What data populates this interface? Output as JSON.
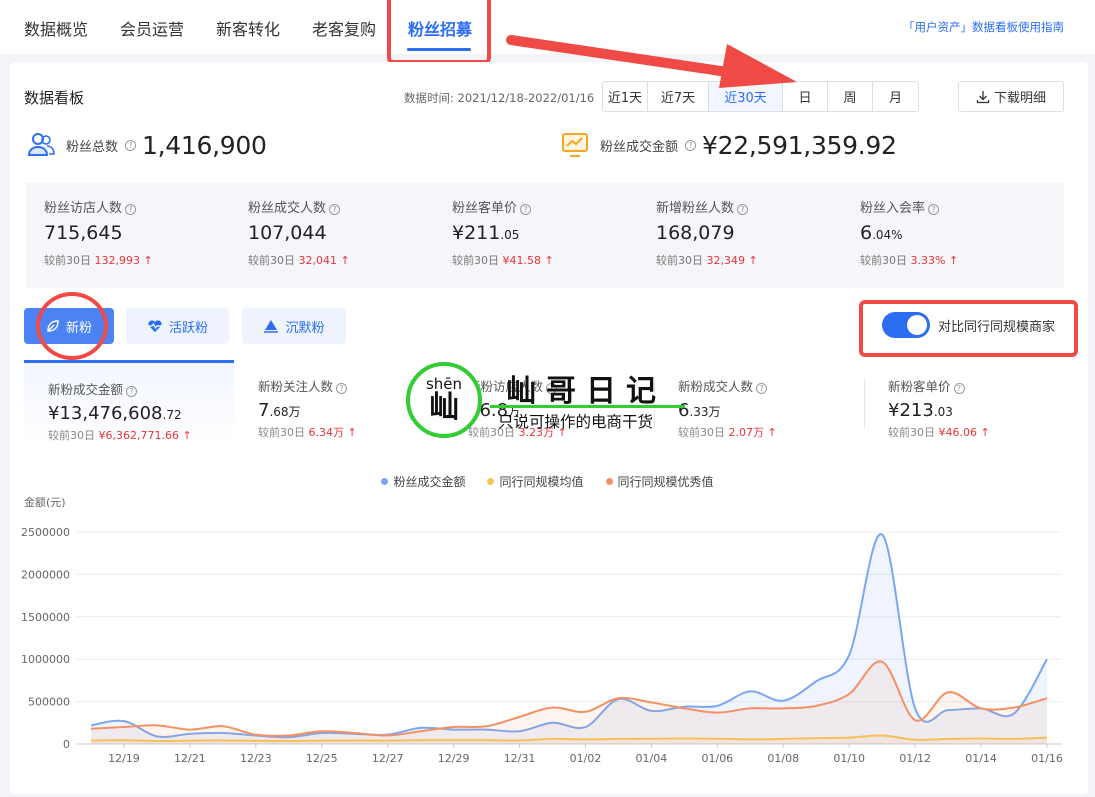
{
  "nav": {
    "tabs": [
      "数据概览",
      "会员运营",
      "新客转化",
      "老客复购",
      "粉丝招募"
    ],
    "active_tab": "粉丝招募",
    "help_link": "「用户资产」数据看板使用指南"
  },
  "panel": {
    "title": "数据看板",
    "data_time_label": "数据时间:",
    "data_time_value": "2021/12/18-2022/01/16",
    "ranges": [
      "近1天",
      "近7天",
      "近30天",
      "日",
      "周",
      "月"
    ],
    "active_range": "近30天",
    "download_label": "下载明细"
  },
  "kpis": [
    {
      "label": "粉丝总数",
      "value": "1,416,900",
      "icon": "users-icon"
    },
    {
      "label": "粉丝成交金额",
      "value": "¥22,591,359.92",
      "icon": "trend-chart-icon"
    }
  ],
  "metrics": [
    {
      "label": "粉丝访店人数",
      "value_main": "715,645",
      "value_small": "",
      "compare_label": "较前30日",
      "compare_value": "132,993"
    },
    {
      "label": "粉丝成交人数",
      "value_main": "107,044",
      "value_small": "",
      "compare_label": "较前30日",
      "compare_value": "32,041"
    },
    {
      "label": "粉丝客单价",
      "value_main": "¥211",
      "value_small": ".05",
      "compare_label": "较前30日",
      "compare_value": "¥41.58"
    },
    {
      "label": "新增粉丝人数",
      "value_main": "168,079",
      "value_small": "",
      "compare_label": "较前30日",
      "compare_value": "32,349"
    },
    {
      "label": "粉丝入会率",
      "value_main": "6",
      "value_small": ".04%",
      "compare_label": "较前30日",
      "compare_value": "3.33%"
    }
  ],
  "segments": [
    {
      "label": "新粉",
      "icon": "leaf-icon"
    },
    {
      "label": "活跃粉",
      "icon": "heart-pulse-icon"
    },
    {
      "label": "沉默粉",
      "icon": "water-drop-icon"
    }
  ],
  "toggle_label": "对比同行同规模商家",
  "sub_metrics": [
    {
      "label": "新粉成交金额",
      "value_main": "¥13,476,608",
      "value_small": ".72",
      "compare_label": "较前30日",
      "compare_value": "¥6,362,771.66"
    },
    {
      "label": "新粉关注人数",
      "value_main": "7",
      "value_small": ".68万",
      "compare_label": "较前30日",
      "compare_value": "6.34万"
    },
    {
      "label": "新粉访店人数",
      "value_main": "16.8",
      "value_small": "万",
      "compare_label": "较前30日",
      "compare_value": "3.23万"
    },
    {
      "label": "新粉成交人数",
      "value_main": "6",
      "value_small": ".33万",
      "compare_label": "较前30日",
      "compare_value": "2.07万"
    },
    {
      "label": "新粉客单价",
      "value_main": "¥213",
      "value_small": ".03",
      "compare_label": "较前30日",
      "compare_value": "¥46.06"
    }
  ],
  "watermark": {
    "pinyin": "shēn",
    "char": "屾",
    "title": "屾哥日记",
    "slogan": "只说可操作的电商干货"
  },
  "colors": {
    "accent": "#2b6ef2",
    "series_blue": "#7ba6f3",
    "series_yellow": "#f7c55a",
    "series_orange": "#f49164",
    "up_red": "#e8343a",
    "annotation_red": "#ef4a45",
    "watermark_green": "#33cc33"
  },
  "chart_data": {
    "type": "line",
    "ylabel": "金额(元)",
    "ylim": [
      0,
      2500000
    ],
    "y_ticks": [
      "0",
      "500000",
      "1000000",
      "1500000",
      "2000000",
      "2500000"
    ],
    "x": [
      "12/18",
      "12/19",
      "12/20",
      "12/21",
      "12/22",
      "12/23",
      "12/24",
      "12/25",
      "12/26",
      "12/27",
      "12/28",
      "12/29",
      "12/30",
      "12/31",
      "01/01",
      "01/02",
      "01/03",
      "01/04",
      "01/05",
      "01/06",
      "01/07",
      "01/08",
      "01/09",
      "01/10",
      "01/11",
      "01/12",
      "01/13",
      "01/14",
      "01/15",
      "01/16"
    ],
    "x_tick_labels": [
      "12/19",
      "12/21",
      "12/23",
      "12/25",
      "12/27",
      "12/29",
      "12/31",
      "01/02",
      "01/04",
      "01/06",
      "01/08",
      "01/10",
      "01/12",
      "01/14",
      "01/16"
    ],
    "series": [
      {
        "name": "粉丝成交金额",
        "values": [
          220000,
          270000,
          90000,
          120000,
          130000,
          100000,
          80000,
          130000,
          120000,
          110000,
          190000,
          170000,
          170000,
          150000,
          250000,
          200000,
          530000,
          390000,
          440000,
          450000,
          620000,
          510000,
          740000,
          1050000,
          2470000,
          420000,
          400000,
          420000,
          360000,
          1000000
        ]
      },
      {
        "name": "同行同规模均值",
        "values": [
          40000,
          45000,
          35000,
          40000,
          42000,
          38000,
          35000,
          40000,
          42000,
          40000,
          45000,
          45000,
          45000,
          42000,
          60000,
          55000,
          60000,
          62000,
          65000,
          62000,
          55000,
          60000,
          70000,
          75000,
          100000,
          50000,
          60000,
          65000,
          60000,
          75000
        ]
      },
      {
        "name": "同行同规模优秀值",
        "values": [
          180000,
          200000,
          220000,
          170000,
          210000,
          110000,
          100000,
          150000,
          130000,
          100000,
          150000,
          200000,
          210000,
          320000,
          430000,
          380000,
          540000,
          490000,
          420000,
          370000,
          420000,
          420000,
          450000,
          590000,
          970000,
          280000,
          610000,
          420000,
          430000,
          540000
        ]
      }
    ]
  }
}
